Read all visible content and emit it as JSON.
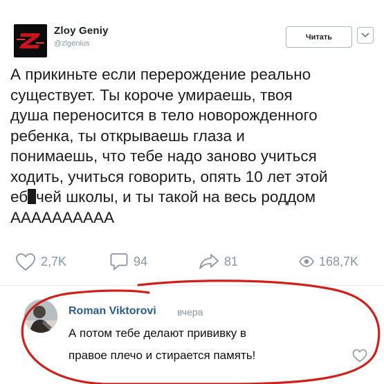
{
  "tweet": {
    "author_name": "Zloy Geniy",
    "author_handle": "@zlgenius",
    "avatar_letter": "Z",
    "follow_label": "Читать",
    "text_lines": [
      "А прикиньте если перерождение реально",
      "существует. Ты короче умираешь, твоя",
      "душа переносится в тело новорожденного",
      "ребенка, ты открываешь глаза и",
      "понимаешь, что тебе надо заново учиться",
      "ходить, учиться говорить, опять 10 лет этой"
    ],
    "line7_prefix": "еб",
    "line7_suffix": "чей школы, и ты такой на весь роддом",
    "text_last_line": "АААААААААА",
    "likes": "2,7K",
    "replies": "94",
    "retweets": "81",
    "views": "168,7K"
  },
  "comment": {
    "author_name": "Roman Viktorovi",
    "time": "вчера",
    "text_lines": [
      "А потом тебе делают прививку в",
      "правое плечо и стирается память!"
    ]
  },
  "colors": {
    "annotation": "#d0201a",
    "link": "#2c5d8f",
    "muted": "#8a969f"
  },
  "icons": {
    "like": "heart-icon",
    "reply": "reply-icon",
    "retweet": "share-arrow-icon",
    "views": "eye-icon",
    "more": "chevron-down-icon",
    "comment_like": "heart-icon"
  }
}
